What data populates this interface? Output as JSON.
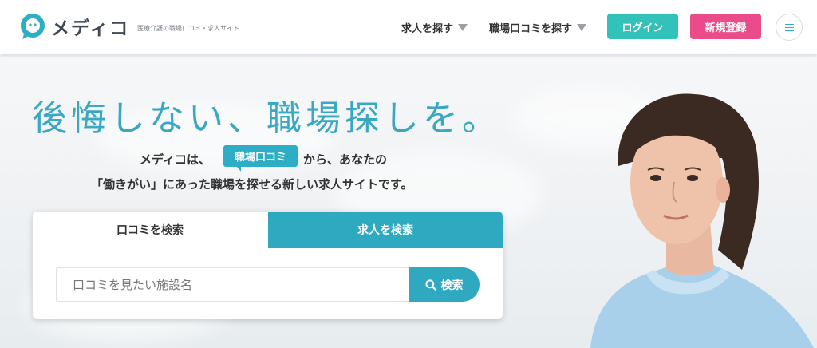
{
  "brand": {
    "name": "メディコ",
    "tagline": "医療介護の職場口コミ・求人サイト",
    "color": "#2eaec4"
  },
  "nav": {
    "find_jobs": "求人を探す",
    "find_reviews": "職場口コミを探す",
    "login": "ログイン",
    "register": "新規登録",
    "menu_icon": "hamburger-icon"
  },
  "hero": {
    "headline": "後悔しない、職場探しを。",
    "sub_pre": "メディコは、",
    "sub_badge": "職場口コミ",
    "sub_post": "から、あなたの",
    "sub_line2": "「働きがい」にあった職場を探せる新しい求人サイトです。"
  },
  "search": {
    "tab_reviews": "口コミを検索",
    "tab_jobs": "求人を検索",
    "placeholder": "口コミを見たい施設名",
    "button": "検索",
    "button_icon": "search-icon"
  },
  "colors": {
    "accent": "#2ea9c0",
    "login": "#33c2b9",
    "register": "#ea4c8a"
  }
}
